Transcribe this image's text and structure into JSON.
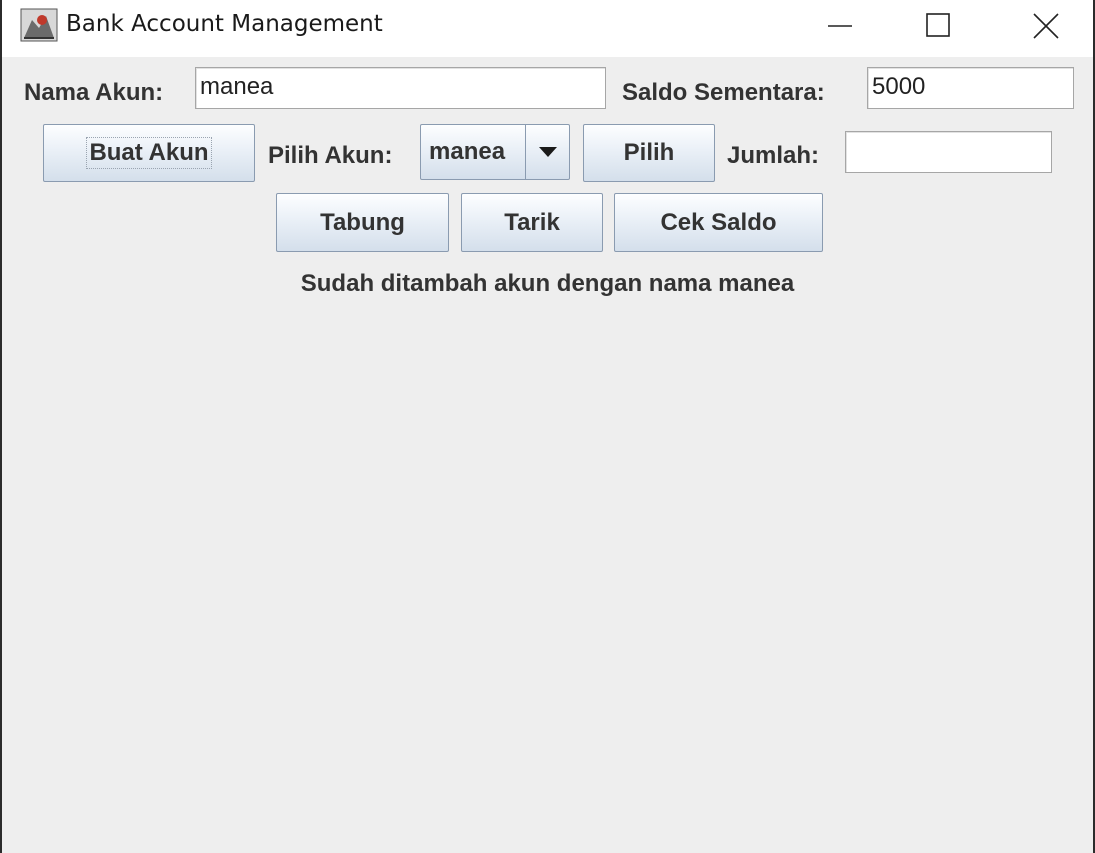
{
  "window": {
    "title": "Bank Account Management",
    "controls": {
      "minimize_icon": "minimize-icon",
      "maximize_icon": "maximize-icon",
      "close_icon": "close-icon"
    }
  },
  "form": {
    "account_name_label": "Nama Akun:",
    "account_name_value": "manea",
    "temp_balance_label": "Saldo Sementara:",
    "temp_balance_value": "5000",
    "create_account_button": "Buat Akun",
    "select_account_label": "Pilih Akun:",
    "selected_account": "manea",
    "select_button": "Pilih",
    "amount_label": "Jumlah:",
    "amount_value": "",
    "deposit_button": "Tabung",
    "withdraw_button": "Tarik",
    "check_balance_button": "Cek Saldo",
    "status_message": "Sudah ditambah akun dengan nama manea"
  },
  "colors": {
    "background": "#eeeeee",
    "text": "#333333",
    "button_border": "#8a9bb0"
  }
}
